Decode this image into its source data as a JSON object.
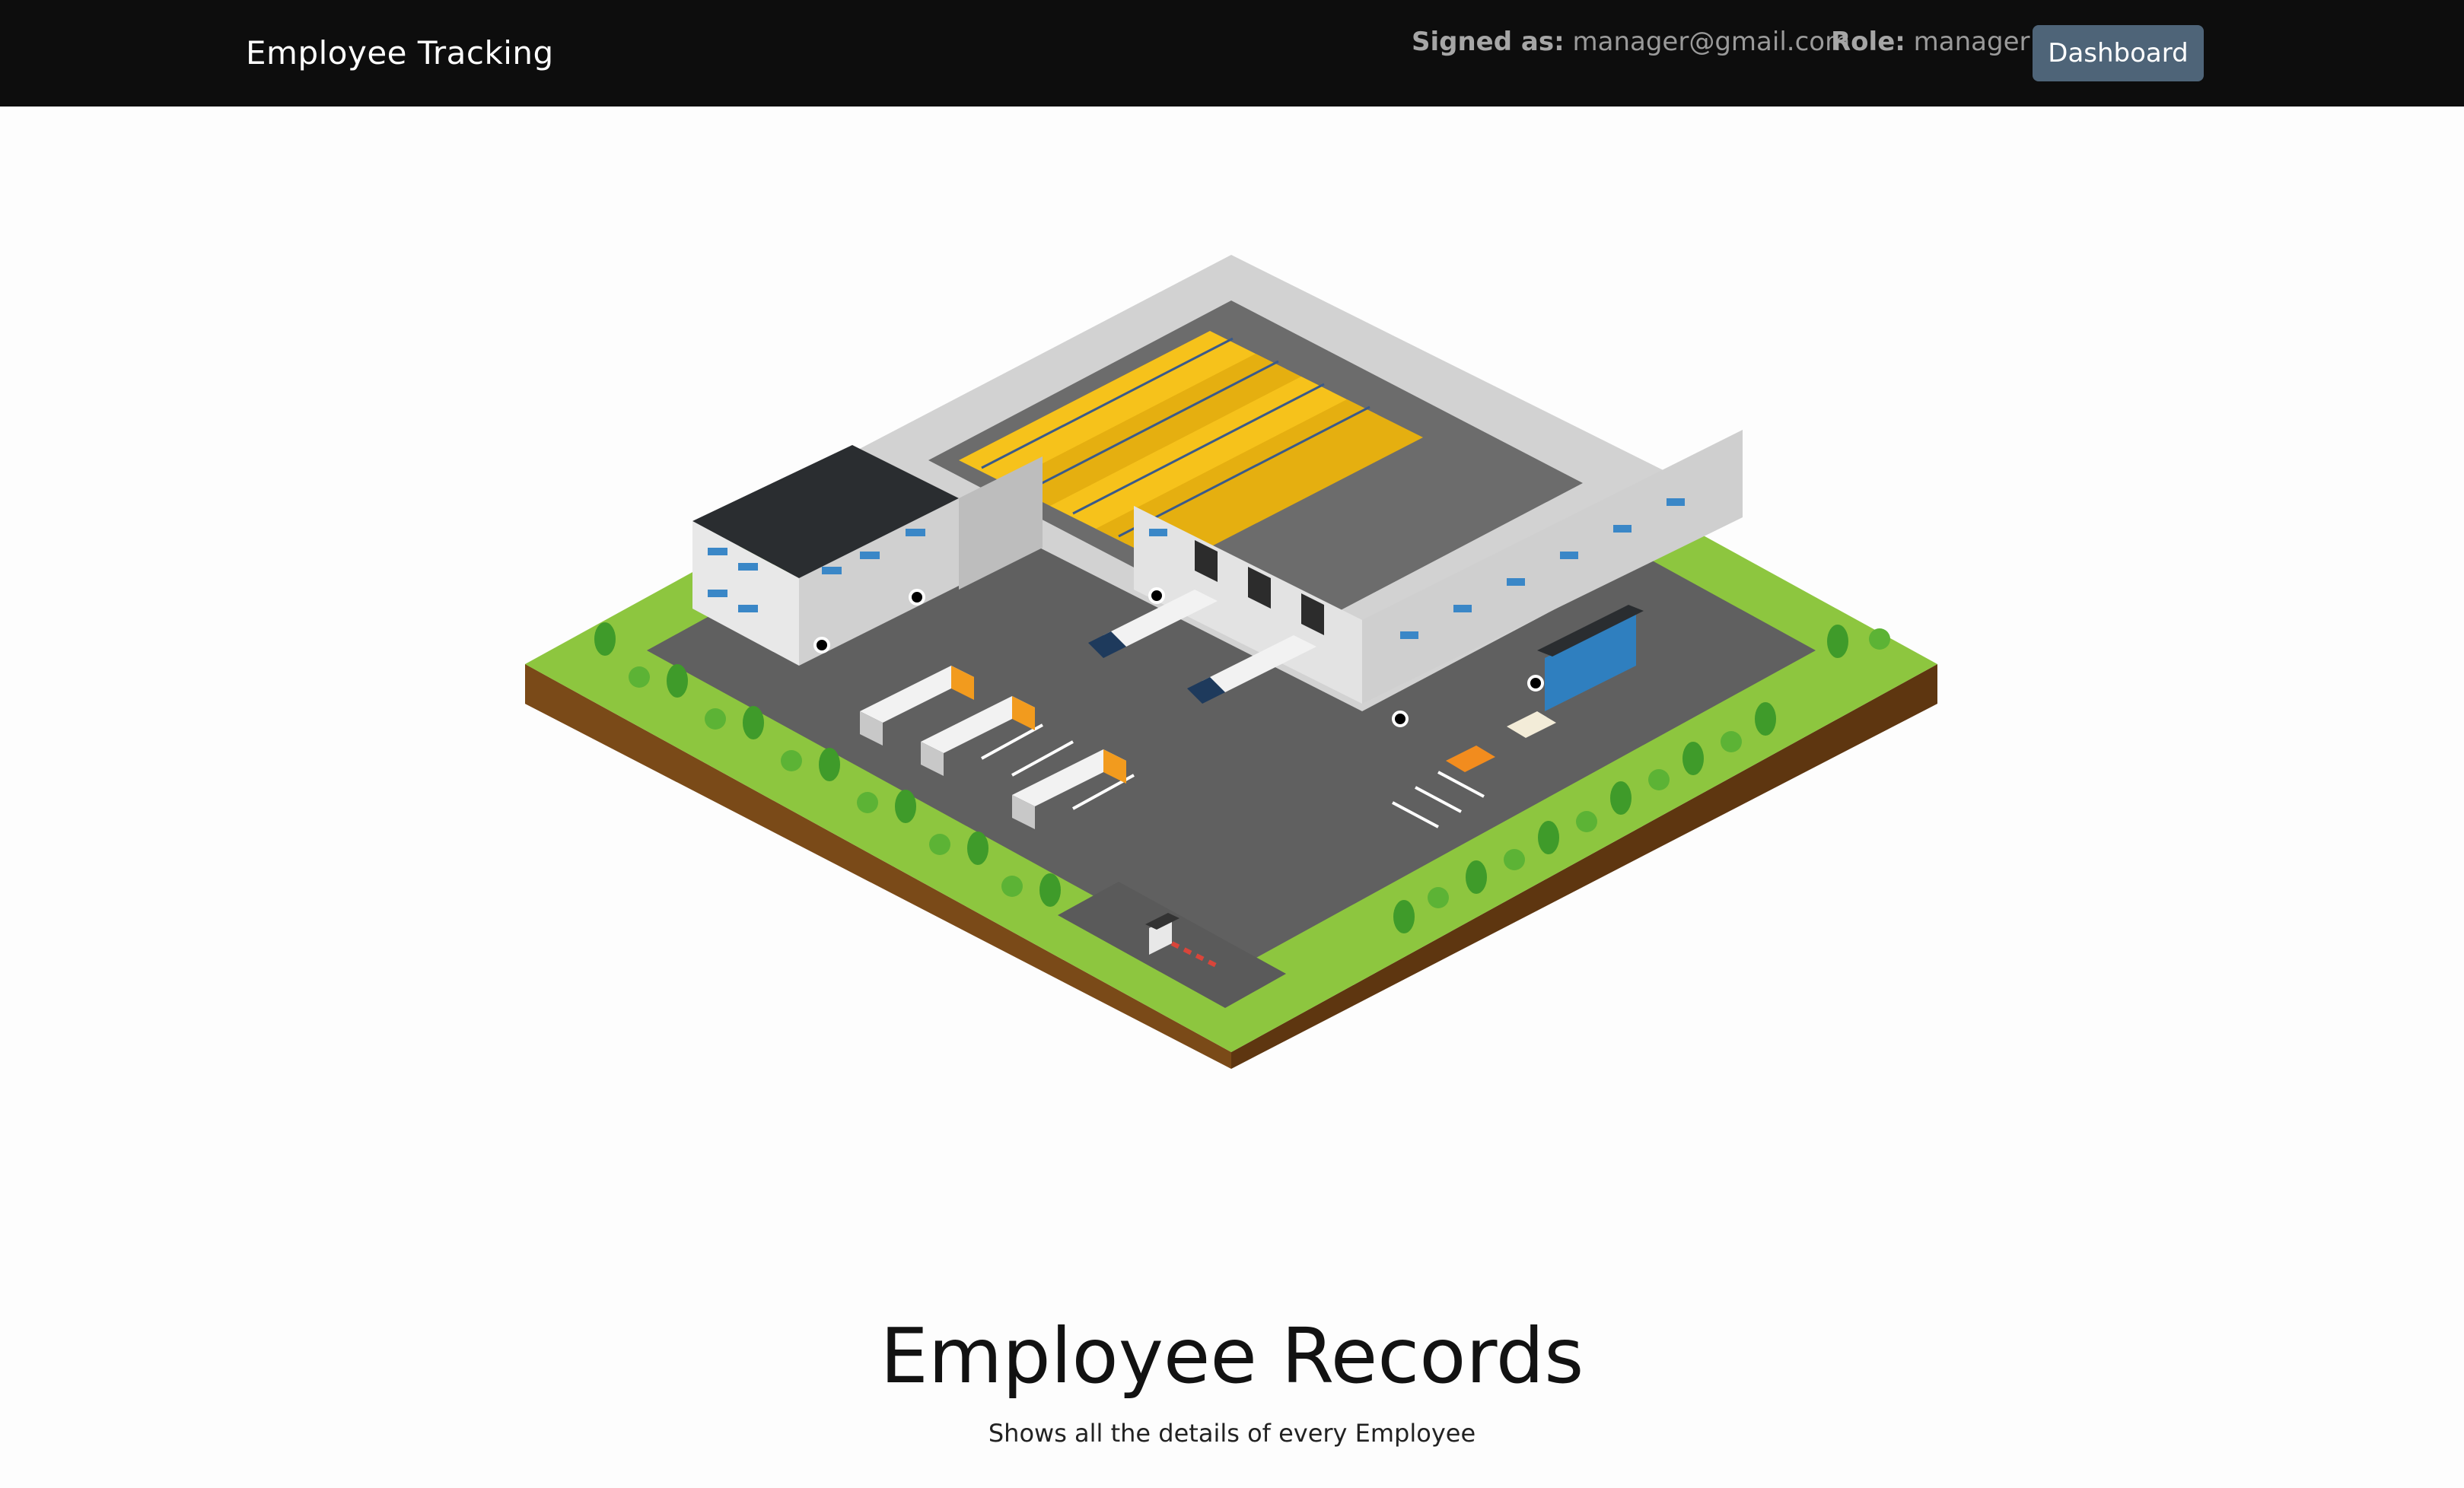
{
  "navbar": {
    "brand": "Employee Tracking",
    "signed_as_label": "Signed as:",
    "signed_as_value": "manager@gmail.com",
    "role_label": "Role:",
    "role_value": "manager",
    "dashboard_button": "Dashboard"
  },
  "illustration": {
    "subject": "isometric-warehouse"
  },
  "hero": {
    "title": "Employee Records",
    "subtitle": "Shows all the details of every Employee"
  },
  "colors": {
    "navbar_bg": "#0d0d0d",
    "button_bg": "#4e6478",
    "grass": "#8dc63f",
    "asphalt": "#5e5e5e",
    "building": "#e3e3e3",
    "boxes": "#f6c21b"
  }
}
